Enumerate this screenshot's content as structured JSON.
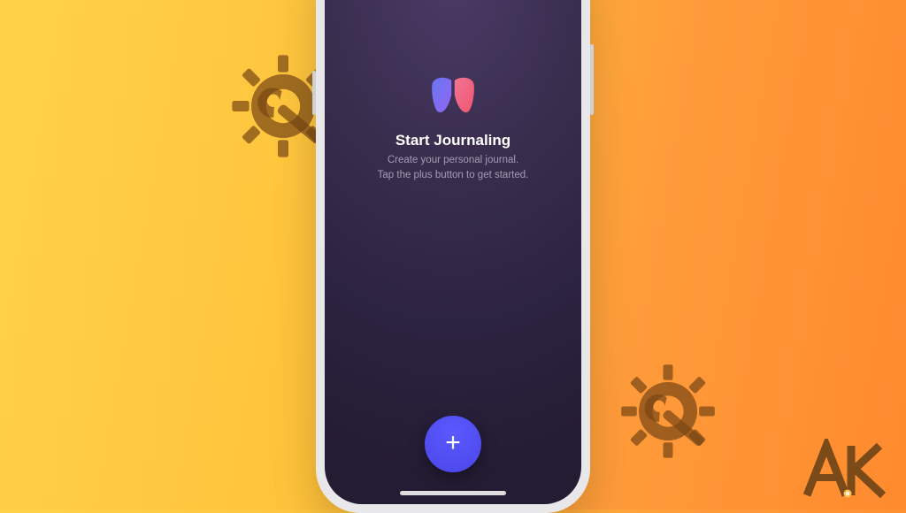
{
  "empty_state": {
    "title": "Start Journaling",
    "subtitle_line1": "Create your personal journal.",
    "subtitle_line2": "Tap the plus button to get started."
  },
  "add_button": {
    "glyph": "+"
  },
  "icons": {
    "app": "journal-book-icon",
    "gear": "gear-wrench-icon",
    "plus": "plus-icon"
  },
  "watermark": {
    "text": "AK"
  },
  "colors": {
    "accent": "#4b46e8",
    "bg_start": "#ffd24a",
    "bg_end": "#ff8a2e",
    "screen_top": "#4a3a66",
    "screen_bottom": "#241c33"
  }
}
